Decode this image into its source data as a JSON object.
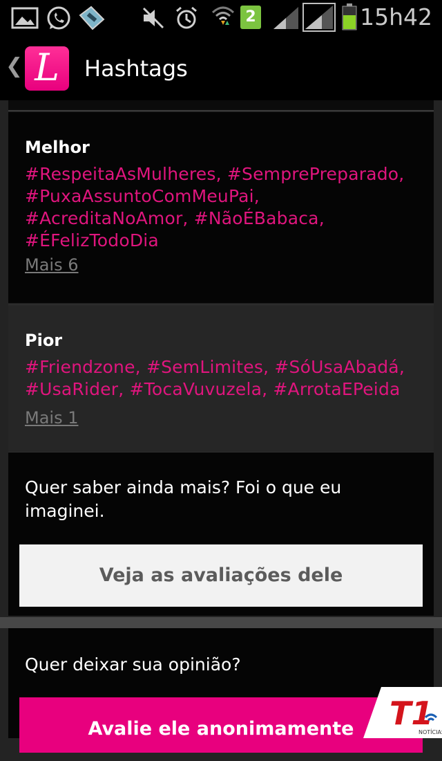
{
  "status_bar": {
    "time": "15h42",
    "notification_count": "2",
    "icons": [
      "image-icon",
      "whatsapp-icon",
      "tag-icon",
      "mute-icon",
      "alarm-icon",
      "wifi-icon",
      "sim-badge-icon",
      "signal-icon",
      "signal-icon",
      "battery-icon"
    ]
  },
  "action_bar": {
    "title": "Hashtags",
    "logo_letter": "L",
    "back_icon": "chevron-left-icon"
  },
  "best": {
    "heading": "Melhor",
    "hashtags": "#RespeitaAsMulheres, #SemprePreparado, #PuxaAssuntoComMeuPai, #AcreditaNoAmor, #NãoÉBabaca, #ÉFelizTodoDia",
    "more_label": "Mais 6"
  },
  "worst": {
    "heading": "Pior",
    "hashtags": "#Friendzone, #SemLimites, #SóUsaAbadá, #UsaRider, #TocaVuvuzela, #ArrotaEPeida",
    "more_label": "Mais 1"
  },
  "more": {
    "text": "Quer saber ainda mais? Foi o que eu imaginei.",
    "button_label": "Veja as avaliações dele"
  },
  "opinion": {
    "text": "Quer deixar sua opinião?",
    "button_label": "Avalie ele anonimamente"
  },
  "watermark": {
    "logo_text": "T1",
    "caption": "NOTÍCIAS"
  },
  "colors": {
    "accent": "#e8007e",
    "hashtag": "#e0157e",
    "background": "#050505"
  }
}
